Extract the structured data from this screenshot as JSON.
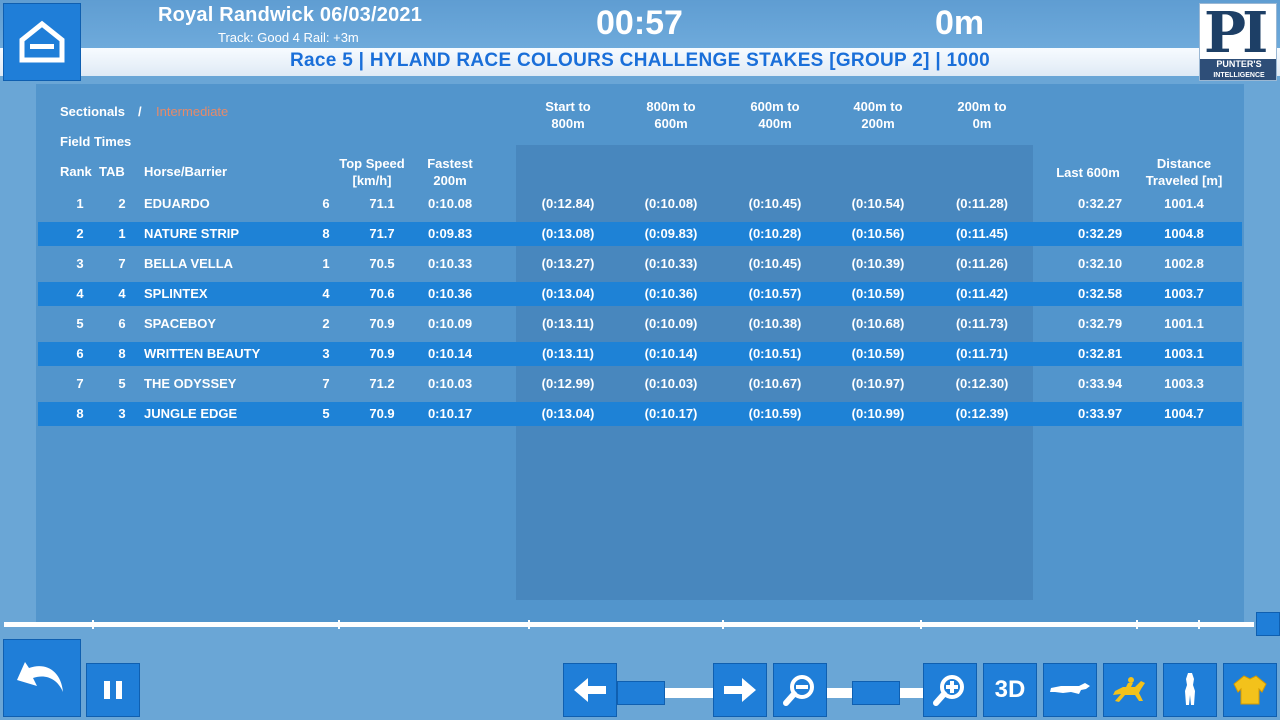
{
  "header": {
    "venue_date": "Royal Randwick 06/03/2021",
    "track_info": "Track: Good 4 Rail: +3m",
    "timer": "00:57",
    "distance": "0m",
    "race_title": "Race 5 | HYLAND RACE COLOURS CHALLENGE STAKES [GROUP 2] | 1000",
    "logo_text_top": "PI",
    "logo_text_1": "PUNTER'S",
    "logo_text_2": "INTELLIGENCE"
  },
  "table": {
    "mode_sectionals": "Sectionals",
    "mode_separator": "/",
    "mode_intermediate": "Intermediate",
    "field_times": "Field Times",
    "headers": {
      "rank": "Rank",
      "tab": "TAB",
      "horse_barrier": "Horse/Barrier",
      "top_speed_1": "Top Speed",
      "top_speed_2": "[km/h]",
      "fastest_1": "Fastest",
      "fastest_2": "200m",
      "s1_1": "Start to",
      "s1_2": "800m",
      "s2_1": "800m to",
      "s2_2": "600m",
      "s3_1": "600m to",
      "s3_2": "400m",
      "s4_1": "400m to",
      "s4_2": "200m",
      "s5_1": "200m to",
      "s5_2": "0m",
      "last600": "Last 600m",
      "dist_1": "Distance",
      "dist_2": "Traveled [m]"
    },
    "rows": [
      {
        "rank": "1",
        "tab": "2",
        "horse": "EDUARDO",
        "barrier": "6",
        "speed": "71.1",
        "fastest": "0:10.08",
        "s1": "(0:12.84)",
        "s2": "(0:10.08)",
        "s3": "(0:10.45)",
        "s4": "(0:10.54)",
        "s5": "(0:11.28)",
        "last600": "0:32.27",
        "dist": "1001.4"
      },
      {
        "rank": "2",
        "tab": "1",
        "horse": "NATURE STRIP",
        "barrier": "8",
        "speed": "71.7",
        "fastest": "0:09.83",
        "s1": "(0:13.08)",
        "s2": "(0:09.83)",
        "s3": "(0:10.28)",
        "s4": "(0:10.56)",
        "s5": "(0:11.45)",
        "last600": "0:32.29",
        "dist": "1004.8"
      },
      {
        "rank": "3",
        "tab": "7",
        "horse": "BELLA VELLA",
        "barrier": "1",
        "speed": "70.5",
        "fastest": "0:10.33",
        "s1": "(0:13.27)",
        "s2": "(0:10.33)",
        "s3": "(0:10.45)",
        "s4": "(0:10.39)",
        "s5": "(0:11.26)",
        "last600": "0:32.10",
        "dist": "1002.8"
      },
      {
        "rank": "4",
        "tab": "4",
        "horse": "SPLINTEX",
        "barrier": "4",
        "speed": "70.6",
        "fastest": "0:10.36",
        "s1": "(0:13.04)",
        "s2": "(0:10.36)",
        "s3": "(0:10.57)",
        "s4": "(0:10.59)",
        "s5": "(0:11.42)",
        "last600": "0:32.58",
        "dist": "1003.7"
      },
      {
        "rank": "5",
        "tab": "6",
        "horse": "SPACEBOY",
        "barrier": "2",
        "speed": "70.9",
        "fastest": "0:10.09",
        "s1": "(0:13.11)",
        "s2": "(0:10.09)",
        "s3": "(0:10.38)",
        "s4": "(0:10.68)",
        "s5": "(0:11.73)",
        "last600": "0:32.79",
        "dist": "1001.1"
      },
      {
        "rank": "6",
        "tab": "8",
        "horse": "WRITTEN BEAUTY",
        "barrier": "3",
        "speed": "70.9",
        "fastest": "0:10.14",
        "s1": "(0:13.11)",
        "s2": "(0:10.14)",
        "s3": "(0:10.51)",
        "s4": "(0:10.59)",
        "s5": "(0:11.71)",
        "last600": "0:32.81",
        "dist": "1003.1"
      },
      {
        "rank": "7",
        "tab": "5",
        "horse": "THE ODYSSEY",
        "barrier": "7",
        "speed": "71.2",
        "fastest": "0:10.03",
        "s1": "(0:12.99)",
        "s2": "(0:10.03)",
        "s3": "(0:10.67)",
        "s4": "(0:10.97)",
        "s5": "(0:12.30)",
        "last600": "0:33.94",
        "dist": "1003.3"
      },
      {
        "rank": "8",
        "tab": "3",
        "horse": "JUNGLE EDGE",
        "barrier": "5",
        "speed": "70.9",
        "fastest": "0:10.17",
        "s1": "(0:13.04)",
        "s2": "(0:10.17)",
        "s3": "(0:10.59)",
        "s4": "(0:10.99)",
        "s5": "(0:12.39)",
        "last600": "0:33.97",
        "dist": "1004.7"
      }
    ]
  },
  "controls": {
    "view_3d_label": "3D",
    "icons": [
      "home-icon",
      "undo-icon",
      "pause-icon",
      "arrow-left-icon",
      "arrow-right-icon",
      "zoom-out-icon",
      "zoom-in-icon",
      "horse-side-icon",
      "jockey-icon",
      "horse-front-icon",
      "silks-icon"
    ]
  },
  "colors": {
    "accent": "#1f7ed8",
    "title_blue": "#1a6fd9",
    "background": "#6aa6d6",
    "panel": "#5295cc",
    "intermediate_inactive": "#e58a6a"
  }
}
